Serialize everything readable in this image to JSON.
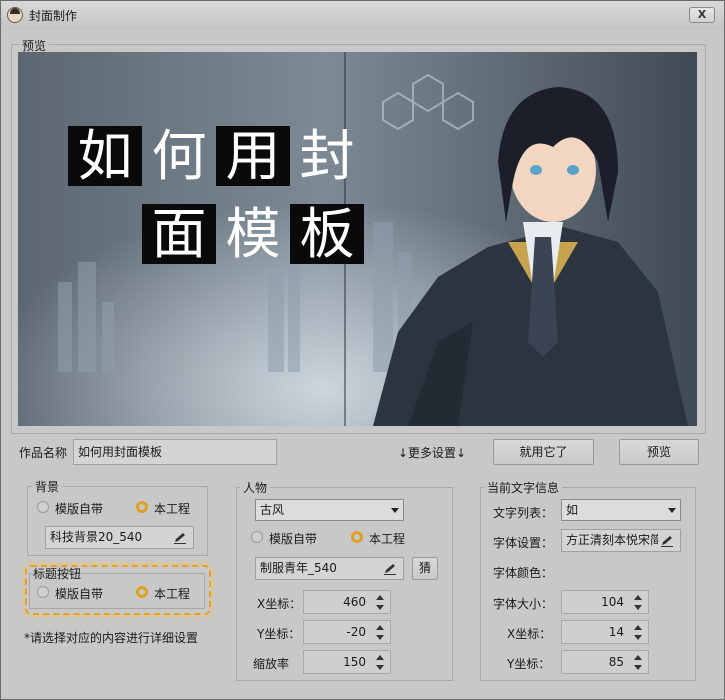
{
  "window": {
    "title": "封面制作",
    "close_label": "X"
  },
  "preview": {
    "group_label": "预览",
    "cover_line1": [
      "如",
      "何",
      "用",
      "封"
    ],
    "cover_line2": [
      "面",
      "模",
      "板"
    ]
  },
  "work": {
    "name_label": "作品名称",
    "name_value": "如何用封面模板",
    "more_settings": "↓更多设置↓",
    "use_button": "就用它了",
    "preview_button": "预览"
  },
  "background": {
    "group_label": "背景",
    "opt_template": "模版自带",
    "opt_project": "本工程",
    "selected": "本工程",
    "file_value": "科技背景20_540"
  },
  "title_button": {
    "group_label": "标题按钮",
    "opt_template": "模版自带",
    "opt_project": "本工程",
    "selected": "本工程"
  },
  "hint": "*请选择对应的内容进行详细设置",
  "character": {
    "group_label": "人物",
    "style_value": "古风",
    "opt_template": "模版自带",
    "opt_project": "本工程",
    "selected": "本工程",
    "file_value": "制服青年_540",
    "guess_button": "猜",
    "x_label": "X坐标：",
    "x_value": "460",
    "y_label": "Y坐标：",
    "y_value": "-20",
    "scale_label": "缩放率",
    "scale_value": "150"
  },
  "text_info": {
    "group_label": "当前文字信息",
    "list_label": "文字列表：",
    "list_value": "如",
    "font_label": "字体设置：",
    "font_value": "方正清刻本悦宋简",
    "color_label": "字体颜色：",
    "size_label": "字体大小：",
    "size_value": "104",
    "x_label": "X坐标：",
    "x_value": "14",
    "y_label": "Y坐标：",
    "y_value": "85"
  },
  "colors": {
    "accent": "#e8a21f"
  }
}
